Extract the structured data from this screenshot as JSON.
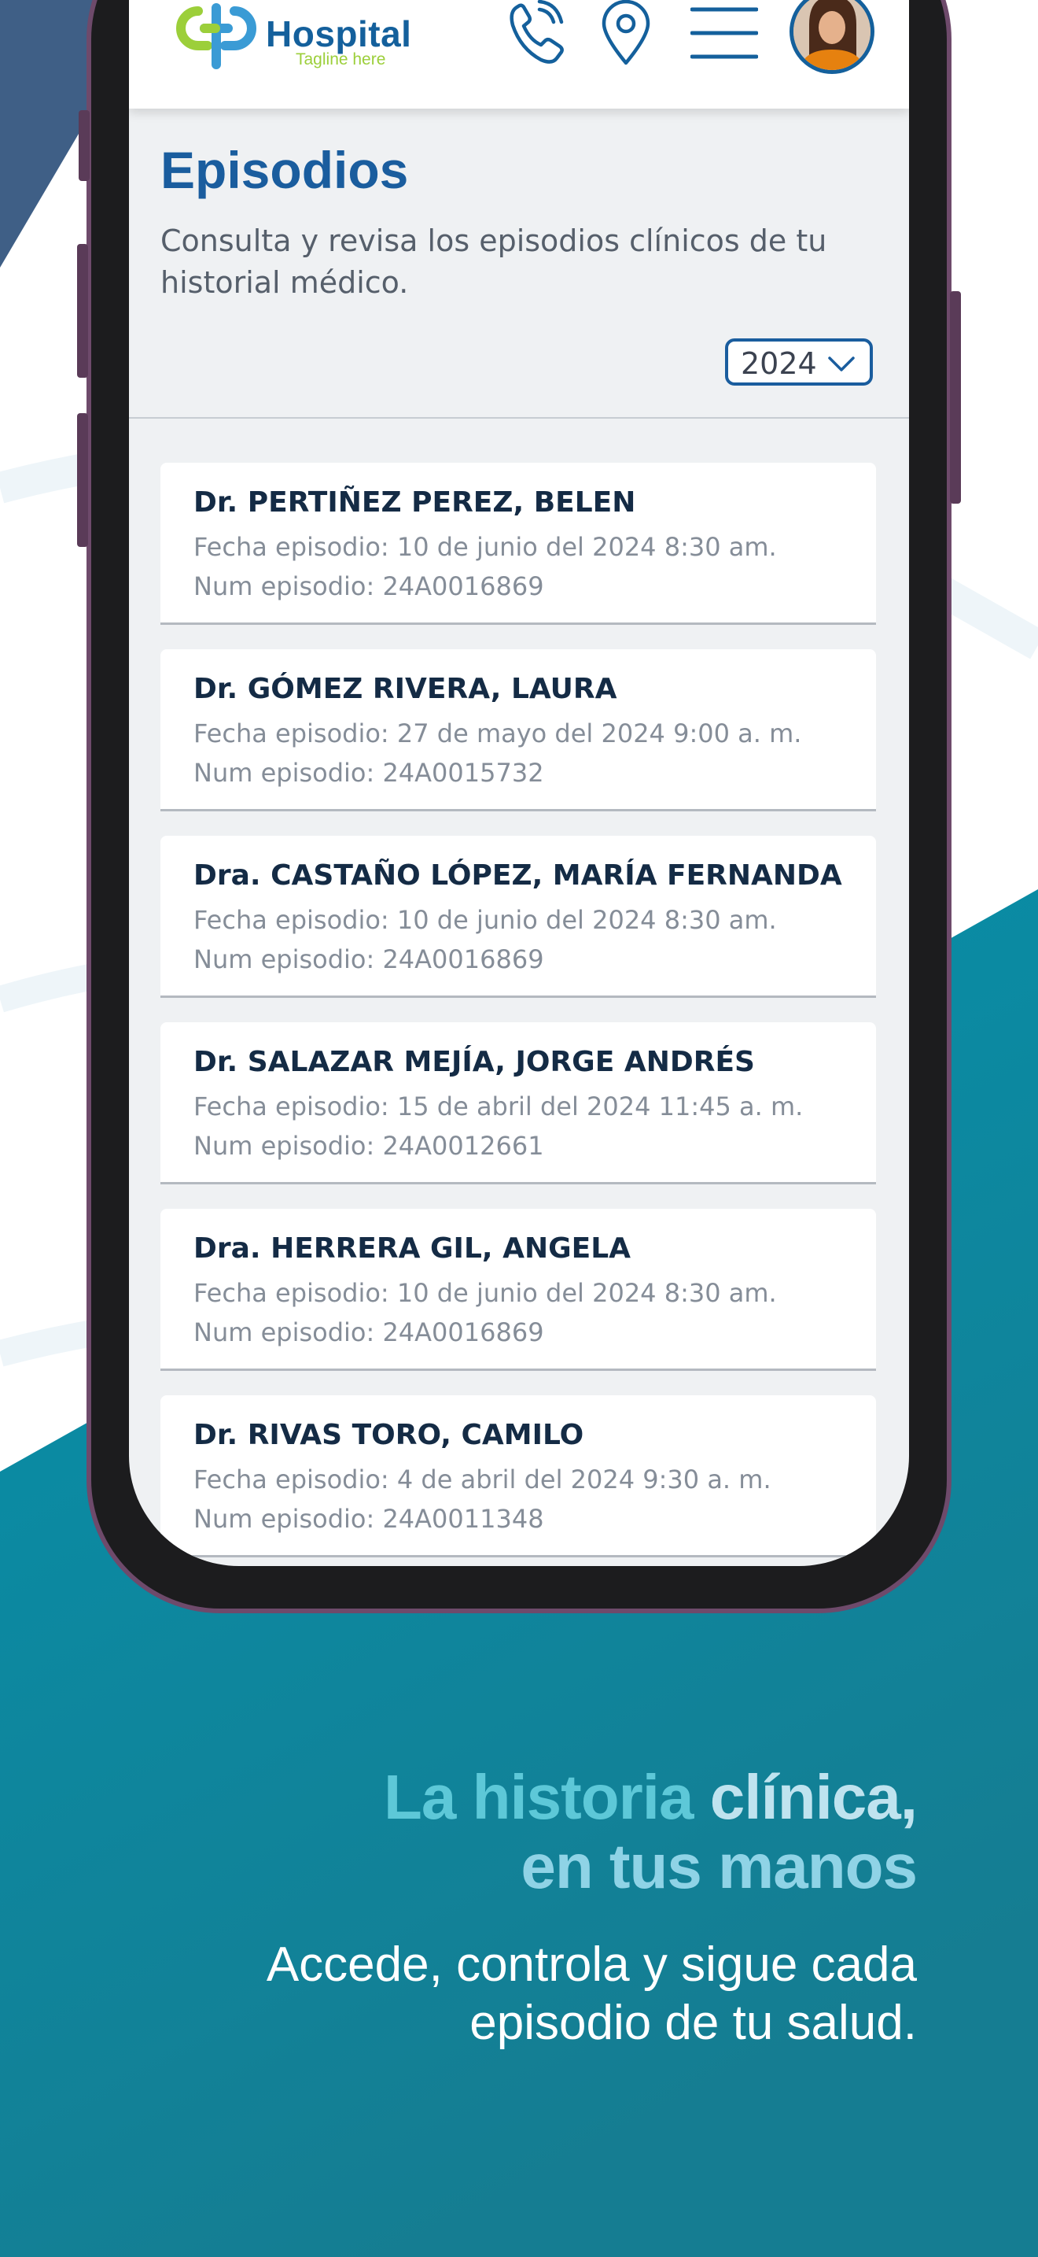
{
  "app": {
    "brand": "Hospital",
    "tagline": "Tagline here"
  },
  "header": {
    "icons": [
      "phone-icon",
      "location-pin-icon",
      "menu-icon",
      "avatar"
    ]
  },
  "page": {
    "title": "Episodios",
    "description": "Consulta y revisa los episodios clínicos de tu historial médico.",
    "year_filter": {
      "selected": "2024"
    }
  },
  "episodes": [
    {
      "doctor": "Dr. PERTIÑEZ PEREZ, BELEN",
      "date": "Fecha episodio: 10 de junio del 2024 8:30 am.",
      "number": "Num episodio: 24A0016869"
    },
    {
      "doctor": "Dr. GÓMEZ RIVERA, LAURA",
      "date": "Fecha episodio: 27 de mayo del 2024 9:00 a. m.",
      "number": "Num episodio: 24A0015732"
    },
    {
      "doctor": "Dra. CASTAÑO LÓPEZ, MARÍA FERNANDA",
      "date": "Fecha episodio: 10 de junio del 2024 8:30 am.",
      "number": "Num episodio: 24A0016869"
    },
    {
      "doctor": "Dr. SALAZAR MEJÍA, JORGE ANDRÉS",
      "date": "Fecha episodio: 15 de abril del 2024 11:45 a. m.",
      "number": "Num episodio: 24A0012661"
    },
    {
      "doctor": "Dra. HERRERA GIL, ANGELA",
      "date": "Fecha episodio: 10 de junio del 2024 8:30 am.",
      "number": "Num episodio: 24A0016869"
    },
    {
      "doctor": "Dr. RIVAS TORO, CAMILO",
      "date": "Fecha episodio: 4 de abril del 2024 9:30 a. m.",
      "number": "Num episodio: 24A0011348"
    }
  ],
  "promo": {
    "title_line1_a": "La historia ",
    "title_line1_b": "clínica,",
    "title_line2": "en tus manos",
    "subtitle_line1": "Accede, controla y sigue cada",
    "subtitle_line2": "episodio de tu salud."
  },
  "colors": {
    "brand_blue": "#14609c",
    "brand_green": "#9ccf3a",
    "teal_background": "#0a8ba3",
    "dark_blue_corner": "#3f5f86"
  }
}
